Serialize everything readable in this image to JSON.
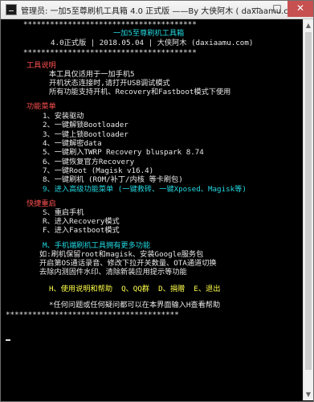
{
  "window": {
    "title": "管理员:  一加5至尊刷机工具箱 4.0 正式版 ——By 大侠阿木 ( daxiaamu.com )",
    "controls": {
      "minimize": "—",
      "maximize": "□",
      "close": "✕"
    }
  },
  "header": {
    "border_top": "***************************************",
    "title": "一加5至尊刷机工具箱",
    "subtitle": "4.0正式版 | 2018.05.04 | 大侠阿木 (daxiaamu.com)",
    "border_bottom": "***************************************"
  },
  "tool_info": {
    "heading": "工具说明",
    "lines": [
      "本工具仅适用于一加手机5",
      "开机状态连接时,请打开USB调试模式",
      "所有功能支持开机、Recovery和Fastboot模式下使用"
    ]
  },
  "function_menu": {
    "heading": "功能菜单",
    "items": [
      "1、安装驱动",
      "2、一键解锁Bootloader",
      "3、一键上锁Bootloader",
      "4、一键解密data",
      "5、一键刷入TWRP Recovery bluspark 8.74",
      "6、一键恢复官方Recovery",
      "7、一键Root (Magisk v16.4)",
      "8、一键刷机 (ROM/补丁/内核 等卡刷包)",
      "9、进入高级功能菜单 (一键救砖、一键Xposed、Magisk等)"
    ]
  },
  "quick_reboot": {
    "heading": "快捷重启",
    "items": [
      "S、重启手机",
      "R、进入Recovery模式",
      "F、进入Fastboot模式"
    ]
  },
  "more_features": {
    "heading": "M、手机端刷机工具拥有更多功能",
    "lines": [
      "如:刷机保留root和magisk、安装Google服务包",
      "开启第OS通话录音、修改下拉开关数量、OTA通道切换",
      "去除内测固件水印、清除新装应用提示等功能"
    ]
  },
  "footer_menu": "H、使用说明和帮助  Q、QQ群  D、捐赠  E、退出",
  "prompt": "*任何问题或任何疑问都可以在本界面输入H查看帮助",
  "border_end": "***************************************"
}
